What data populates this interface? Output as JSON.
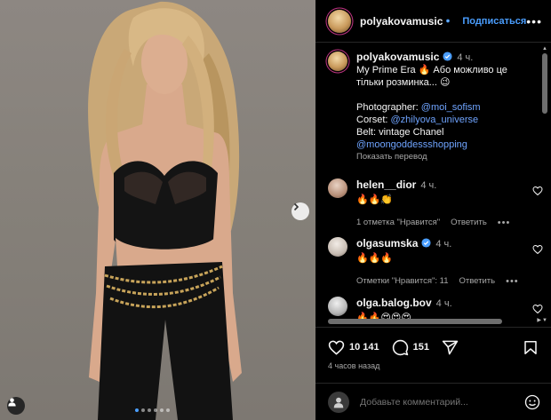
{
  "post": {
    "username": "polyakovamusic",
    "follow_label": "Подписаться",
    "more_label": "•••",
    "caption": {
      "time": "4 ч.",
      "line1": "My Prime Era 🔥 Або можливо це",
      "line2": "тільки розминка... 😉",
      "photographer_label": "Photographer: ",
      "photographer_link": "@moi_sofism",
      "corset_label": "Corset: ",
      "corset_link": "@zhilyova_universe",
      "belt_label": "Belt: vintage Chanel",
      "belt_link": "@moongoddessshopping",
      "translate": "Показать перевод"
    },
    "comments": [
      {
        "user": "helen__dior",
        "time": "4 ч.",
        "text": "🔥🔥👏",
        "likes": "1 отметка \"Нравится\"",
        "reply": "Ответить",
        "more": "•••"
      },
      {
        "user": "olgasumska",
        "time": "4 ч.",
        "text": "🔥🔥🔥",
        "likes": "Отметки \"Нравится\": 11",
        "reply": "Ответить",
        "more": "•••"
      },
      {
        "user": "olga.balog.bov",
        "time": "4 ч.",
        "text": "🔥🔥😍😍😍"
      }
    ],
    "likes_count": "10 141",
    "comments_count": "151",
    "posted": "4 часов назад",
    "add_comment_placeholder": "Добавьте комментарий..."
  },
  "carousel": {
    "total": 6,
    "active": 0
  },
  "icons": {
    "next": "chevron-right-icon",
    "tag": "user-tag-icon",
    "like": "heart-icon",
    "comment": "comment-bubble-icon",
    "share": "paper-plane-icon",
    "save": "bookmark-icon",
    "emoji": "emoji-smile-icon",
    "verified": "verified-badge-icon"
  },
  "colors": {
    "accent": "#4a9eff",
    "link": "#6fa4ff",
    "background": "#000000",
    "muted": "#a8a8a8"
  }
}
